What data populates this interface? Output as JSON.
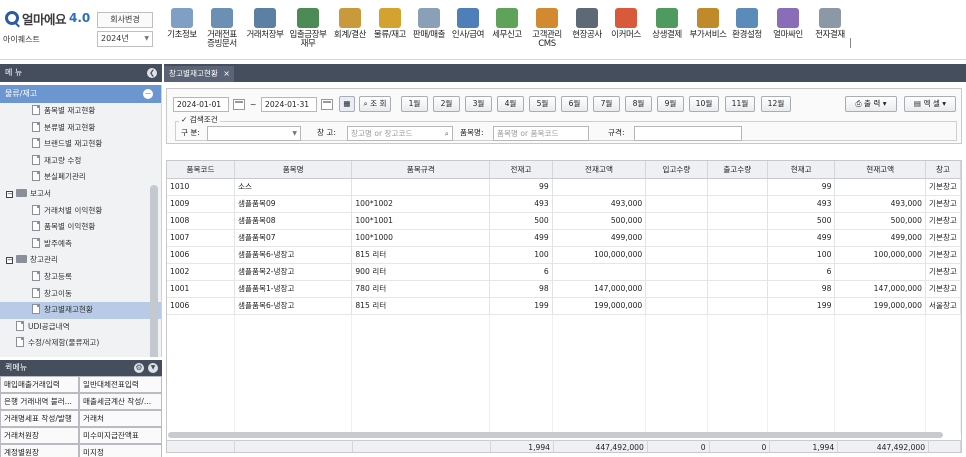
{
  "header": {
    "brand": "얼마에요",
    "version": "4.0",
    "company_label": "아이퀘스트",
    "company_change_button": "회사변경",
    "year": "2024년",
    "menu": [
      {
        "label": "기초정보",
        "icon": "basic-info-icon",
        "color": "#7f9fc4"
      },
      {
        "label": "거래전표\n증빙문서",
        "icon": "voucher-icon",
        "color": "#6c8fb4"
      },
      {
        "label": "거래처장부",
        "icon": "ledger-icon",
        "color": "#5c7fa4"
      },
      {
        "label": "입출금장부\n재무",
        "icon": "cash-icon",
        "color": "#4c8b56"
      },
      {
        "label": "회계/결산",
        "icon": "accounting-icon",
        "color": "#c99a3b"
      },
      {
        "label": "물류/재고",
        "icon": "logistics-icon",
        "color": "#d4a22f"
      },
      {
        "label": "판매/매출",
        "icon": "sales-icon",
        "color": "#8aa0b9"
      },
      {
        "label": "인사/급여",
        "icon": "hr-icon",
        "color": "#4f7fb8"
      },
      {
        "label": "세무신고",
        "icon": "tax-icon",
        "color": "#5fa25a"
      },
      {
        "label": "고객관리\nCMS",
        "icon": "customer-icon",
        "color": "#d3892f"
      },
      {
        "label": "현장공사",
        "icon": "construction-icon",
        "color": "#5d6a76"
      },
      {
        "label": "이커머스",
        "icon": "ecommerce-icon",
        "color": "#d95a3a"
      },
      {
        "label": "상생결제",
        "icon": "payment-icon",
        "color": "#4f9a5e"
      },
      {
        "label": "부가서비스",
        "icon": "service-icon",
        "color": "#c08a2a"
      },
      {
        "label": "환경설정",
        "icon": "settings-icon",
        "color": "#5b8bb8"
      },
      {
        "label": "얼마싸인",
        "icon": "sign-icon",
        "color": "#8a6db8"
      },
      {
        "label": "전자결재",
        "icon": "approval-icon",
        "color": "#8d98a6"
      }
    ]
  },
  "sidebar": {
    "title": "메 뉴",
    "group": "물류/재고",
    "items": [
      {
        "label": "품목별 재고현황",
        "kind": "doc",
        "indent": 1
      },
      {
        "label": "분류별 재고현황",
        "kind": "doc",
        "indent": 1
      },
      {
        "label": "브랜드별 재고현황",
        "kind": "doc",
        "indent": 1
      },
      {
        "label": "재고량 수정",
        "kind": "doc",
        "indent": 1
      },
      {
        "label": "분실폐기관리",
        "kind": "doc",
        "indent": 1
      },
      {
        "label": "보고서",
        "kind": "folder",
        "indent": 0
      },
      {
        "label": "거래처별 이익현황",
        "kind": "doc",
        "indent": 1
      },
      {
        "label": "품목별 이익현황",
        "kind": "doc",
        "indent": 1
      },
      {
        "label": "발주예측",
        "kind": "doc",
        "indent": 1
      },
      {
        "label": "창고관리",
        "kind": "folder",
        "indent": 0
      },
      {
        "label": "창고등록",
        "kind": "doc",
        "indent": 1
      },
      {
        "label": "창고이동",
        "kind": "doc",
        "indent": 1
      },
      {
        "label": "창고별재고현황",
        "kind": "doc",
        "indent": 1,
        "selected": true
      },
      {
        "label": "UDI공급내역",
        "kind": "doc",
        "indent": 0
      },
      {
        "label": "수정/삭제함(물류재고)",
        "kind": "doc",
        "indent": 0
      }
    ],
    "favorites_title": "퀵메뉴",
    "favorites": [
      "매입매출거래입력",
      "일반대체전표입력",
      "은행 거래내역 불러...",
      "매출세금계산 작성/...",
      "거래명세표 작성/발행",
      "거래처",
      "거래처원장",
      "미수미지급잔액표",
      "계정별원장",
      "미지정"
    ]
  },
  "tab": {
    "title": "창고별재고현황"
  },
  "toolbar": {
    "date_from": "2024-01-01",
    "date_to": "2024-01-31",
    "tilde": "~",
    "search_button": "조 회",
    "months": [
      "1월",
      "2월",
      "3월",
      "4월",
      "5월",
      "6월",
      "7월",
      "8월",
      "9월",
      "10월",
      "11월",
      "12월"
    ],
    "print_button": "출 력",
    "excel_button": "엑 셀",
    "condition_title": "검색조건",
    "category_label": "구 분:",
    "warehouse_label": "창 고:",
    "warehouse_placeholder": "창고명 or 창고코드",
    "item_label": "품목명:",
    "item_placeholder": "품목명 or 품목코드",
    "spec_label": "규격:"
  },
  "grid": {
    "columns": [
      "품목코드",
      "품목명",
      "품목규격",
      "전재고",
      "전재고액",
      "입고수량",
      "출고수량",
      "현재고",
      "현재고액",
      "창고"
    ],
    "rows": [
      [
        "1010",
        "소스",
        "",
        "99",
        "",
        "",
        "",
        "99",
        "",
        "기본창고"
      ],
      [
        "1009",
        "샘플품목09",
        "100*1002",
        "493",
        "493,000",
        "",
        "",
        "493",
        "493,000",
        "기본창고"
      ],
      [
        "1008",
        "샘플품목08",
        "100*1001",
        "500",
        "500,000",
        "",
        "",
        "500",
        "500,000",
        "기본창고"
      ],
      [
        "1007",
        "샘플품목07",
        "100*1000",
        "499",
        "499,000",
        "",
        "",
        "499",
        "499,000",
        "기본창고"
      ],
      [
        "1006",
        "샘플품목6-냉장고",
        "815 리터",
        "100",
        "100,000,000",
        "",
        "",
        "100",
        "100,000,000",
        "기본창고"
      ],
      [
        "1002",
        "샘플품목2-냉장고",
        "900 리터",
        "6",
        "",
        "",
        "",
        "6",
        "",
        "기본창고"
      ],
      [
        "1001",
        "샘플품목1-냉장고",
        "780 리터",
        "98",
        "147,000,000",
        "",
        "",
        "98",
        "147,000,000",
        "기본창고"
      ],
      [
        "1006",
        "샘플품목6-냉장고",
        "815 리터",
        "199",
        "199,000,000",
        "",
        "",
        "199",
        "199,000,000",
        "서울창고"
      ]
    ],
    "totals": [
      "",
      "",
      "",
      "1,994",
      "447,492,000",
      "0",
      "0",
      "1,994",
      "447,492,000",
      ""
    ]
  }
}
